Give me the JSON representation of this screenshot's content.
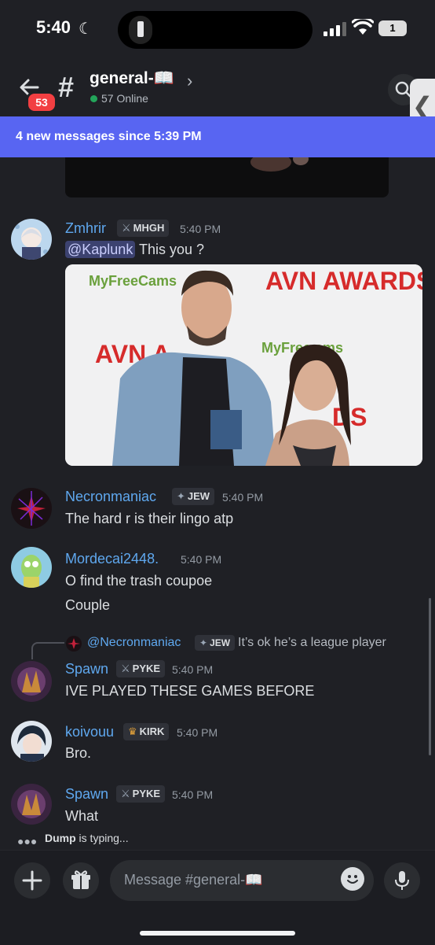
{
  "status_bar": {
    "time": "5:40",
    "battery": "1"
  },
  "header": {
    "unread_count": "53",
    "channel_name": "general-📖",
    "online": "57 Online"
  },
  "banner": {
    "text": "4 new messages since 5:39 PM"
  },
  "messages": [
    {
      "user": "Zmhrir",
      "role": "MHGH",
      "time": "5:40 PM",
      "mention": "@Kaplunk",
      "text": " This you ?"
    },
    {
      "user": "Necronmaniac",
      "role": "JEW",
      "time": "5:40 PM",
      "text": "The hard r is their lingo atp"
    },
    {
      "user": "Mordecai2448.",
      "time": "5:40 PM",
      "text": "O find the trash coupoe",
      "text2": "Couple"
    },
    {
      "reply_user": "@Necronmaniac",
      "reply_role": "JEW",
      "reply_text": "It’s ok he’s a league player",
      "user": "Spawn",
      "role": "PYKE",
      "time": "5:40 PM",
      "text": "IVE PLAYED THESE GAMES BEFORE"
    },
    {
      "user": "koivouu",
      "role": "KIRK",
      "time": "5:40 PM",
      "text": "Bro."
    },
    {
      "user": "Spawn",
      "role": "PYKE",
      "time": "5:40 PM",
      "text": "What"
    }
  ],
  "photo": {
    "banner_left": "MyFreeCams",
    "banner_right": "AVN AWARDS"
  },
  "typing": {
    "user": "Dump",
    "suffix": " is typing..."
  },
  "composer": {
    "placeholder": "Message #general-📖"
  },
  "colors": {
    "accent": "#5865f2",
    "username": "#5fa8ef",
    "online": "#23a55a",
    "badge": "#f23f42"
  }
}
